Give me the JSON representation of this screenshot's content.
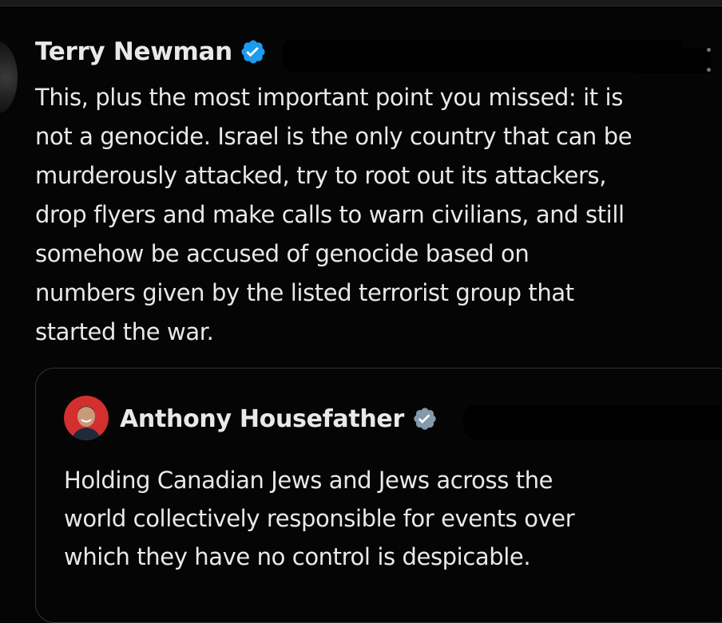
{
  "tweet": {
    "author_name": "Terry Newman",
    "verified_icon": "verified-badge-blue",
    "verified_color": "#1d9bf0",
    "body": "This, plus the most important point you missed: it is\nnot a genocide. Israel is the only country that can be\nmurderously attacked, try to root out its attackers,\ndrop flyers and make calls to warn civilians, and still\nsomehow be accused of genocide based on\nnumbers given by the listed terrorist group that\nstarted the war."
  },
  "quoted_tweet": {
    "author_name": "Anthony Housefather",
    "verified_icon": "verified-badge-grey",
    "verified_color": "#829aab",
    "avatar_bg": "#d32f2f",
    "body": "Holding Canadian Jews and Jews across the\nworld collectively responsible for events over\nwhich they have no control is despicable."
  },
  "more_icon": "more-options-icon",
  "colors": {
    "background": "#050505",
    "text": "#e7e9ea",
    "border": "#2f3336"
  }
}
